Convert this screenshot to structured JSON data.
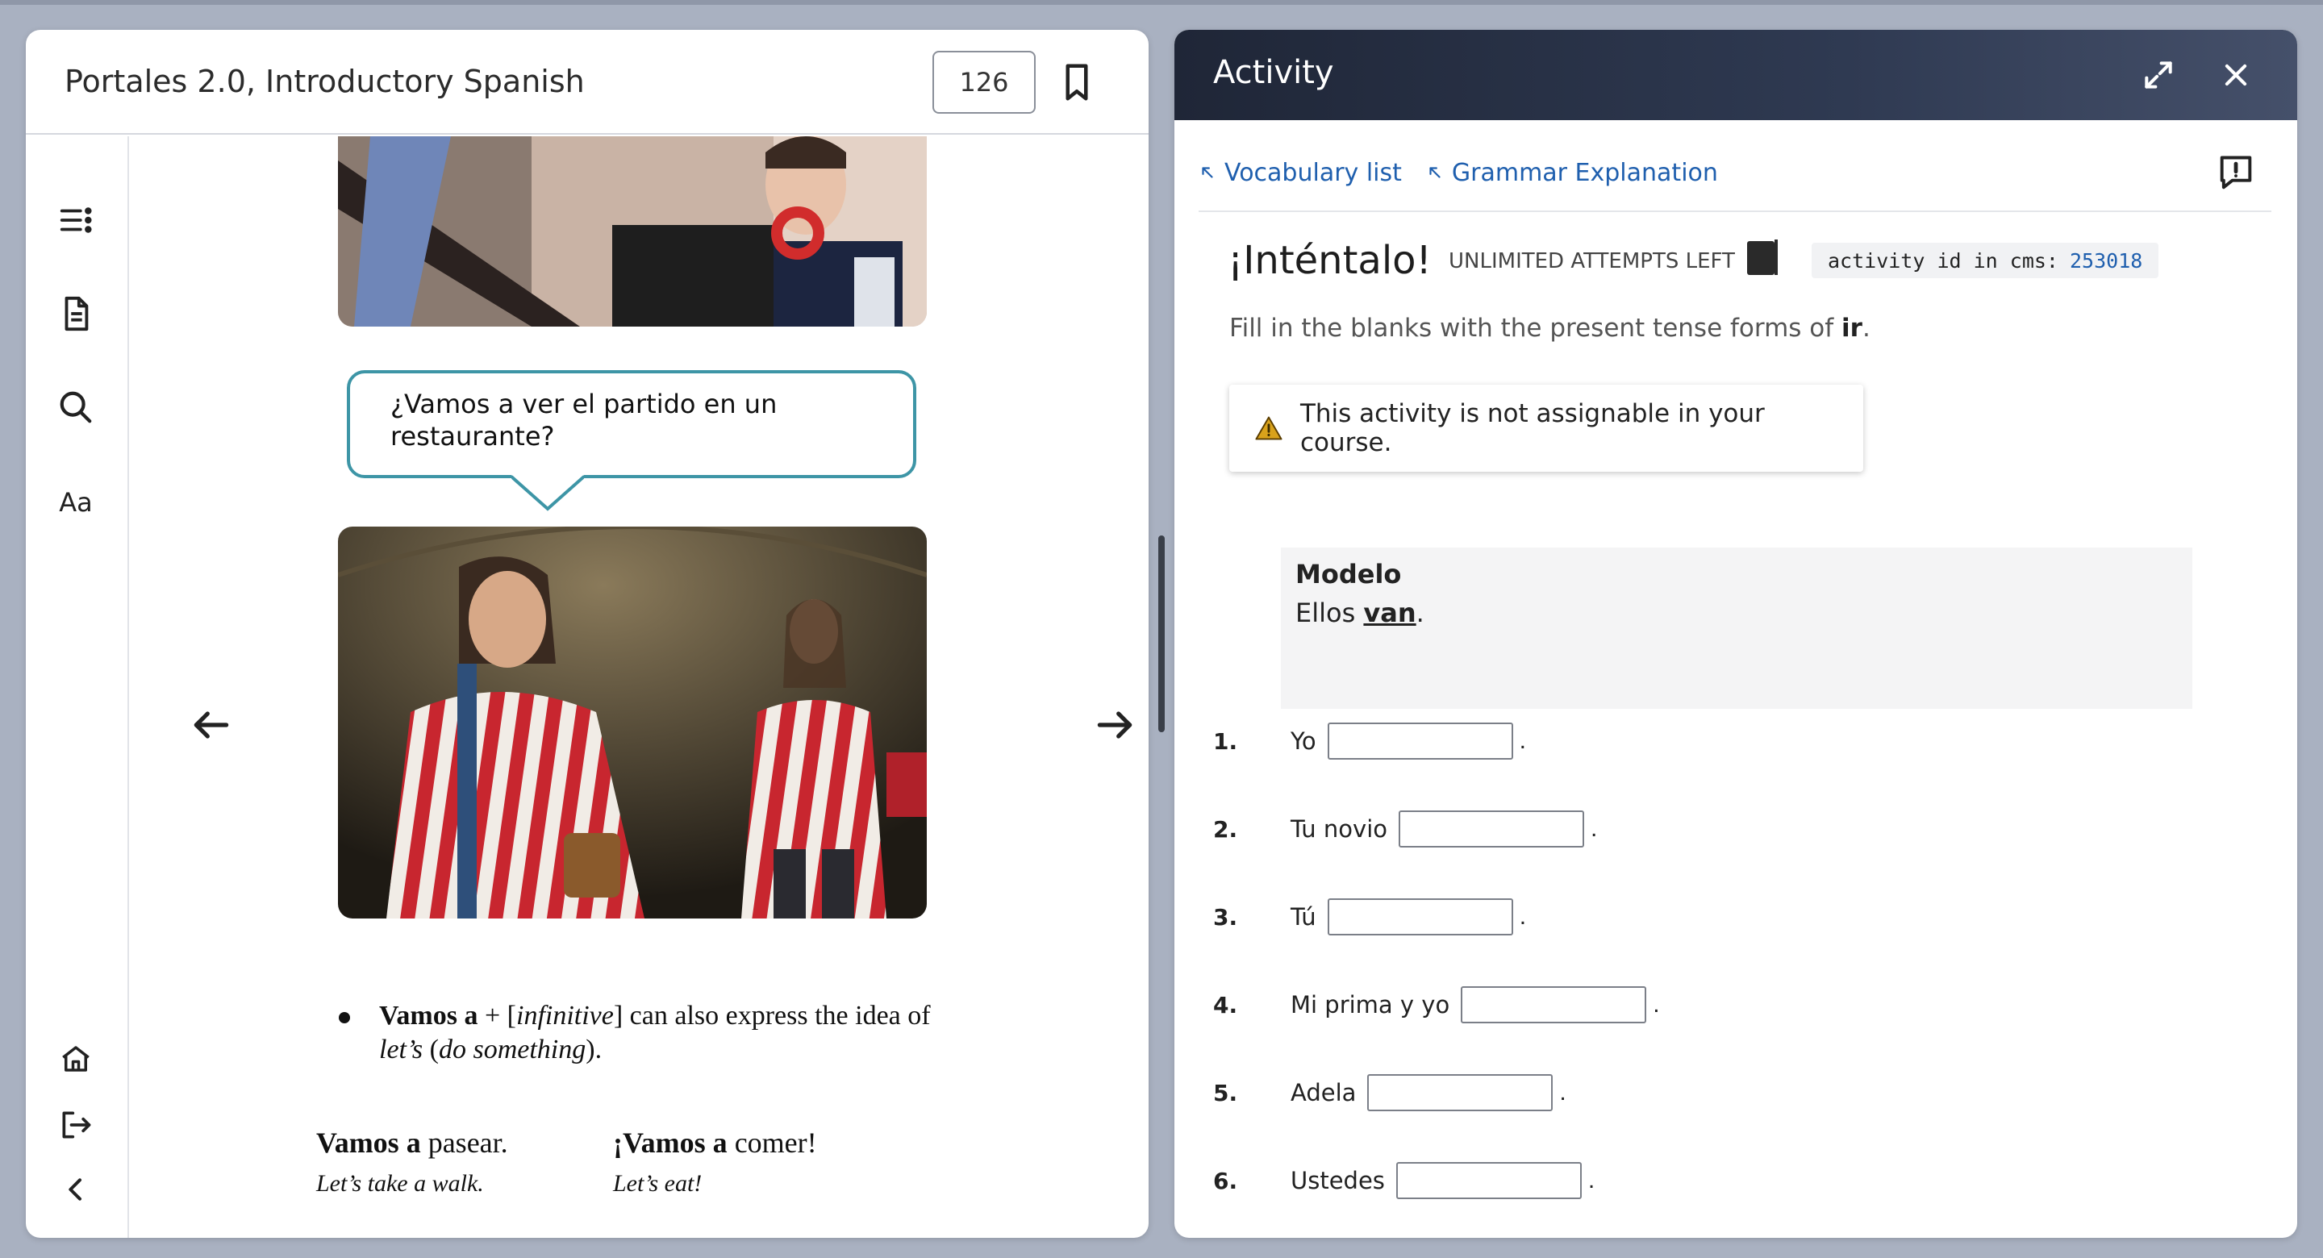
{
  "reader": {
    "book_title": "Portales 2.0, Introductory Spanish",
    "page_number": "126",
    "rail": {
      "aa_label": "Aa"
    },
    "bubble_text": "¿Vamos a ver el partido en un restaurante?",
    "bullet": {
      "bold": "Vamos a",
      "plus": " + [",
      "infinitive": "infinitive",
      "rest": "] can also express the idea of",
      "line2_italic_a": "let’s",
      "line2_paren_open": " (",
      "line2_italic_b": "do something",
      "line2_paren_close": ")."
    },
    "examples": [
      {
        "es_bold": "Vamos a",
        "es_rest": " pasear.",
        "en": "Let’s take a walk."
      },
      {
        "es_bold": "¡Vamos a",
        "es_rest": " comer!",
        "en": "Let’s eat!"
      }
    ]
  },
  "activity": {
    "panel_title": "Activity",
    "links": [
      {
        "label": "Vocabulary list"
      },
      {
        "label": "Grammar Explanation"
      }
    ],
    "heading": "¡Inténtalo!",
    "attempts": "UNLIMITED ATTEMPTS LEFT",
    "cms_label": "activity id in cms:",
    "cms_id": "253018",
    "instructions_prefix": "Fill in the blanks with the present tense forms of ",
    "instructions_verb": "ir",
    "instructions_suffix": ".",
    "warning": "This activity is not assignable in your course.",
    "modelo": {
      "heading": "Modelo",
      "subject": "Ellos ",
      "answer": "van",
      "end": "."
    },
    "questions": [
      {
        "num": "1.",
        "subject": "Yo",
        "value": ""
      },
      {
        "num": "2.",
        "subject": "Tu novio",
        "value": ""
      },
      {
        "num": "3.",
        "subject": "Tú",
        "value": ""
      },
      {
        "num": "4.",
        "subject": "Mi prima y yo",
        "value": ""
      },
      {
        "num": "5.",
        "subject": "Adela",
        "value": ""
      },
      {
        "num": "6.",
        "subject": "Ustedes",
        "value": ""
      }
    ],
    "period": "."
  },
  "colors": {
    "link_blue": "#1f5fae",
    "bubble_border": "#3d95a6",
    "warning_amber": "#d9a21b",
    "header_dark": "#1f2637"
  }
}
